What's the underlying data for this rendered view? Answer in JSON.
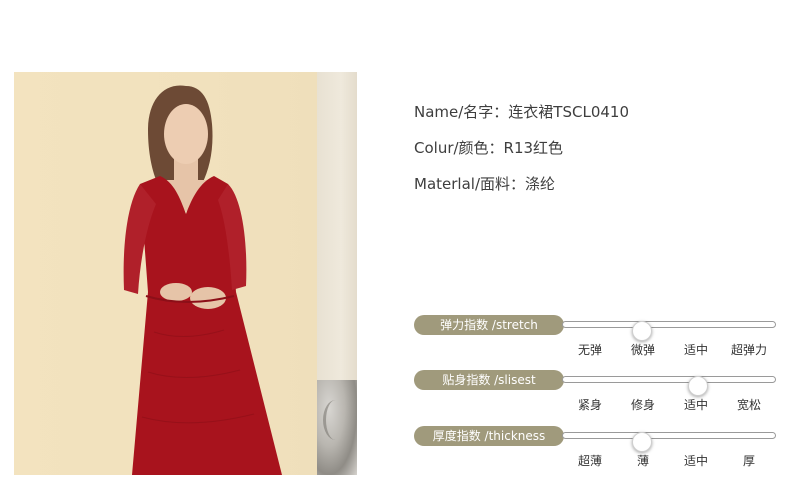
{
  "info": {
    "name_line": "Name/名字：连衣裙TSCL0410",
    "colour_line": "Colur/颜色：R13红色",
    "material_line": "Materlal/面料：涤纶"
  },
  "gauges": [
    {
      "title": "弹力指数 /stretch",
      "labels": [
        "无弹",
        "微弹",
        "适中",
        "超弹力"
      ],
      "level_index": 1
    },
    {
      "title": "贴身指数 /slisest",
      "labels": [
        "紧身",
        "修身",
        "适中",
        "宽松"
      ],
      "level_index": 2
    },
    {
      "title": "厚度指数 /thickness",
      "labels": [
        "超薄",
        "薄",
        "适中",
        "厚"
      ],
      "level_index": 1
    }
  ],
  "colors": {
    "pill": "#a09a7c",
    "dress": "#a8131d"
  }
}
